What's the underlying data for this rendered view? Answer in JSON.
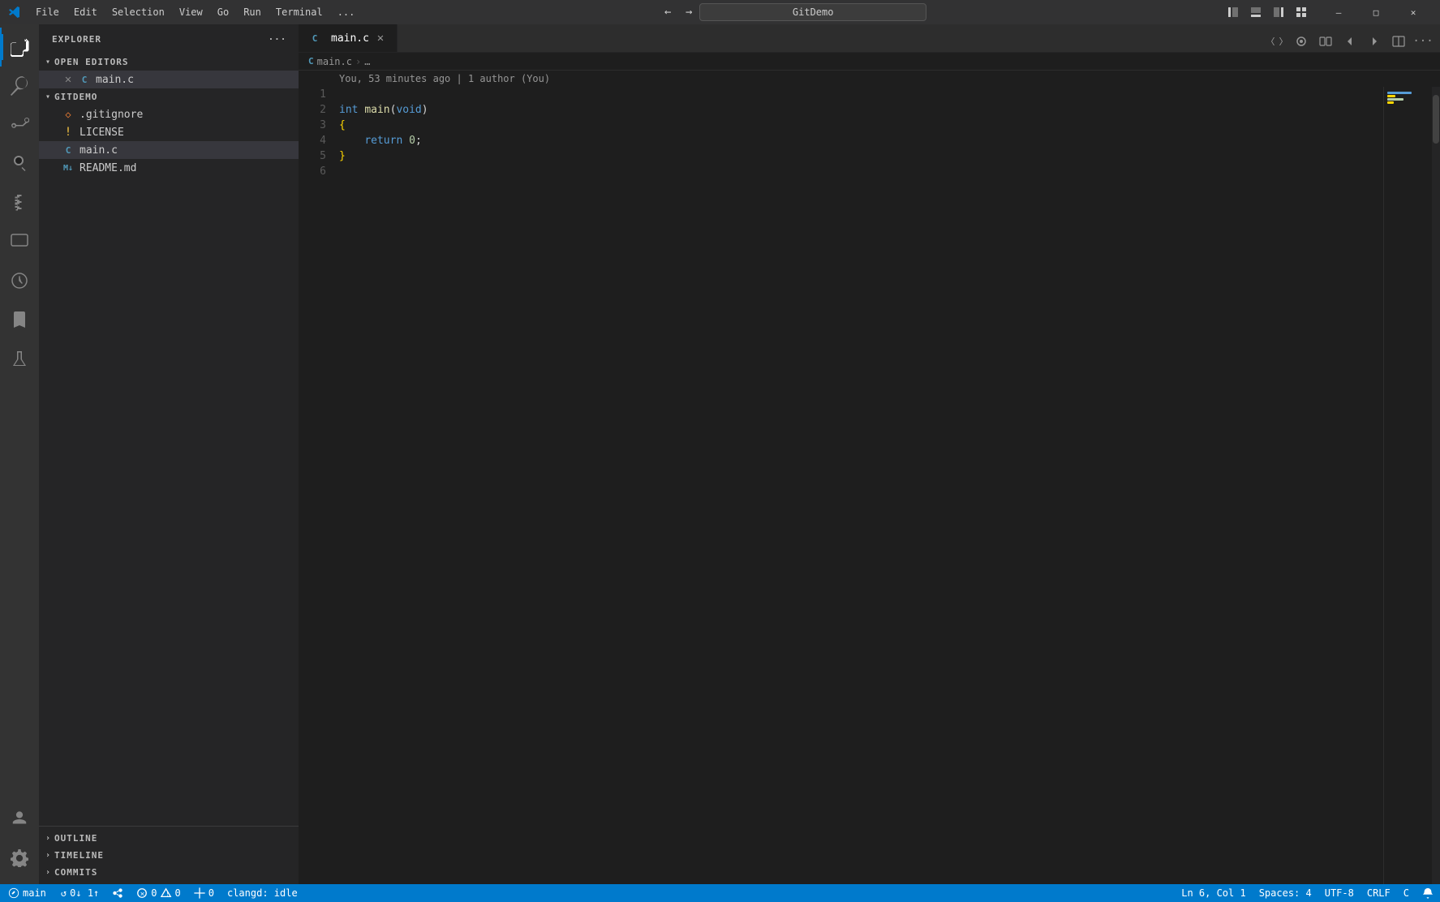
{
  "titleBar": {
    "appName": "GitDemo",
    "menus": [
      "File",
      "Edit",
      "Selection",
      "View",
      "Go",
      "Run",
      "Terminal",
      "..."
    ],
    "searchPlaceholder": "GitDemo",
    "navBack": "←",
    "navForward": "→",
    "winMinimize": "—",
    "winMaximize": "☐",
    "winClose": "✕"
  },
  "activityBar": {
    "icons": [
      {
        "name": "explorer-icon",
        "symbol": "⎘",
        "active": true
      },
      {
        "name": "search-icon",
        "symbol": "🔍",
        "active": false
      },
      {
        "name": "source-control-icon",
        "symbol": "⑂",
        "active": false
      },
      {
        "name": "run-debug-icon",
        "symbol": "▷",
        "active": false
      },
      {
        "name": "extensions-icon",
        "symbol": "⊞",
        "active": false
      },
      {
        "name": "remote-explorer-icon",
        "symbol": "🖥",
        "active": false
      },
      {
        "name": "timeline-icon",
        "symbol": "⏱",
        "active": false
      },
      {
        "name": "bookmarks-icon",
        "symbol": "🔖",
        "active": false
      },
      {
        "name": "testing-icon",
        "symbol": "⚗",
        "active": false
      }
    ],
    "bottomIcons": [
      {
        "name": "accounts-icon",
        "symbol": "👤"
      },
      {
        "name": "settings-icon",
        "symbol": "⚙"
      }
    ]
  },
  "sidebar": {
    "title": "EXPLORER",
    "moreActionsLabel": "···",
    "sections": {
      "openEditors": {
        "label": "OPEN EDITORS",
        "files": [
          {
            "name": "main.c",
            "icon": "C",
            "iconColor": "#519aba",
            "modified": true,
            "active": true
          }
        ]
      },
      "gitDemo": {
        "label": "GITDEMO",
        "files": [
          {
            "name": ".gitignore",
            "icon": "◇",
            "iconColor": "#e37933",
            "indent": 1
          },
          {
            "name": "LICENSE",
            "icon": "!",
            "iconColor": "#f0c040",
            "indent": 1
          },
          {
            "name": "main.c",
            "icon": "C",
            "iconColor": "#519aba",
            "indent": 1,
            "active": true
          },
          {
            "name": "README.md",
            "icon": "M",
            "iconColor": "#519aba",
            "indent": 1
          }
        ]
      }
    },
    "bottomSections": [
      {
        "label": "OUTLINE",
        "collapsed": true
      },
      {
        "label": "TIMELINE",
        "collapsed": true
      },
      {
        "label": "COMMITS",
        "collapsed": true
      }
    ]
  },
  "editor": {
    "tab": {
      "filename": "main.c",
      "icon": "C",
      "iconColor": "#519aba",
      "modified": false
    },
    "breadcrumb": {
      "path": [
        "main.c",
        "…"
      ]
    },
    "blame": {
      "text": "You, 53 minutes ago | 1 author (You)"
    },
    "lines": [
      {
        "num": 1,
        "content": ""
      },
      {
        "num": 2,
        "content": "int main(void)"
      },
      {
        "num": 3,
        "content": "{"
      },
      {
        "num": 4,
        "content": "    return 0;"
      },
      {
        "num": 5,
        "content": "}"
      },
      {
        "num": 6,
        "content": ""
      }
    ]
  },
  "statusBar": {
    "branch": "main",
    "syncIcon": "↺",
    "syncCount": "0↓ 1↑",
    "liveShareIcon": "⊕",
    "errorsCount": "0",
    "warningsCount": "0",
    "portsIcon": "⊘",
    "portsCount": "0",
    "langServer": "clangd: idle",
    "position": "Ln 6, Col 1",
    "spaces": "Spaces: 4",
    "encoding": "UTF-8",
    "lineEnding": "CRLF",
    "language": "C",
    "notifications": "🔔"
  }
}
